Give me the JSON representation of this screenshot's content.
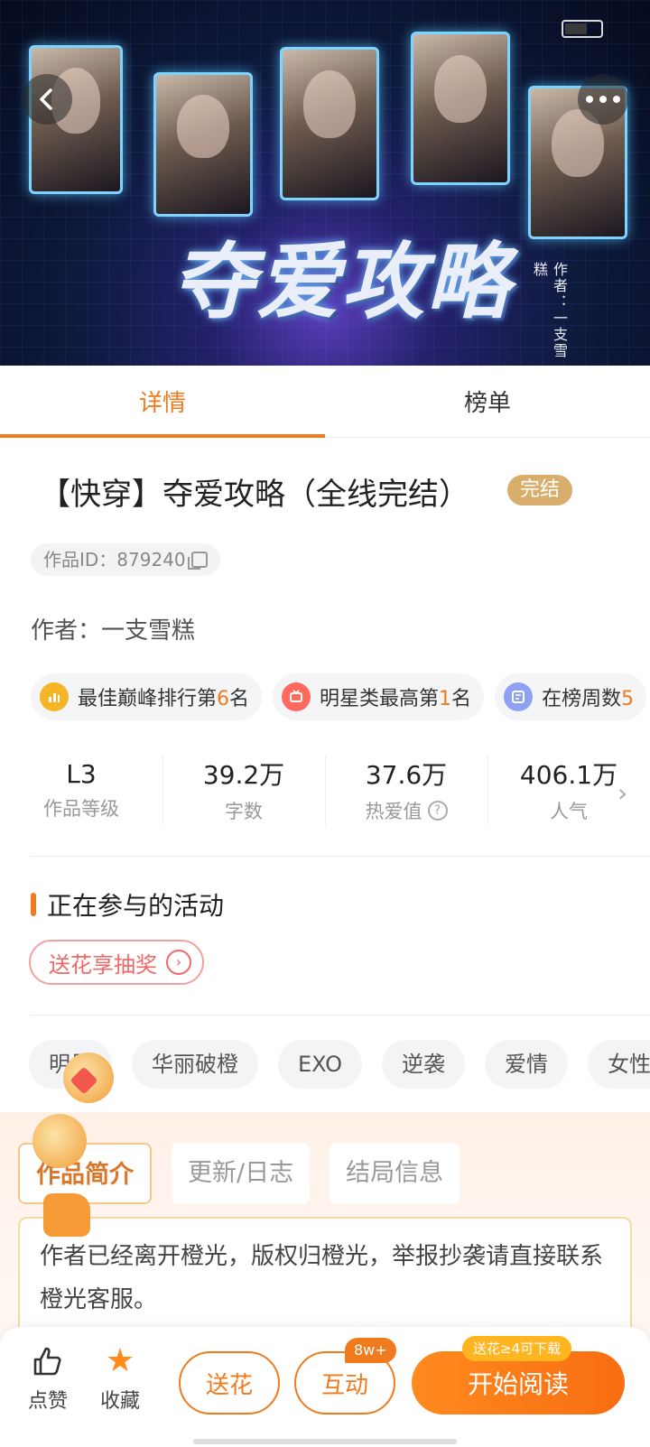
{
  "banner": {
    "title_art": "夺爱攻略",
    "author_art": "作者：一支雪糕",
    "back_glyph": "‹",
    "more_glyph": "•••"
  },
  "tabs": [
    {
      "label": "详情",
      "active": true
    },
    {
      "label": "榜单",
      "active": false
    }
  ],
  "book": {
    "title": "【快穿】夺爱攻略（全线完结）",
    "status_badge": "完结",
    "id_label": "作品ID：879240",
    "author_label": "作者：",
    "author_name": "一支雪糕"
  },
  "rank_chips": [
    {
      "prefix": "最佳巅峰排行第",
      "num": "6",
      "suffix": "名",
      "icon": "bar-chart-icon",
      "color": "#f5b526"
    },
    {
      "prefix": "明星类最高第",
      "num": "1",
      "suffix": "名",
      "icon": "tv-icon",
      "color": "#ff6a5e"
    },
    {
      "prefix": "在榜周数",
      "num": "5",
      "suffix": "",
      "icon": "list-icon",
      "color": "#8ea1f2"
    }
  ],
  "stats": [
    {
      "value": "L3",
      "label": "作品等级"
    },
    {
      "value": "39.2万",
      "label": "字数"
    },
    {
      "value": "37.6万",
      "label": "热爱值"
    },
    {
      "value": "406.1万",
      "label": "人气"
    }
  ],
  "activity": {
    "section_title": "正在参与的活动",
    "button_label": "送花享抽奖"
  },
  "tags": [
    "明星",
    "华丽破橙",
    "EXO",
    "逆袭",
    "爱情",
    "女性向"
  ],
  "intro": {
    "subtabs": [
      {
        "label": "作品简介",
        "active": true
      },
      {
        "label": "更新/日志",
        "active": false
      },
      {
        "label": "结局信息",
        "active": false
      }
    ],
    "text": "作者已经离开橙光，版权归橙光，举报抄袭请直接联系橙光客服。"
  },
  "bottom_bar": {
    "like_label": "点赞",
    "fav_label": "收藏",
    "flower_label": "送花",
    "interact_label": "互动",
    "interact_count": "8w+",
    "read_label": "开始阅读",
    "download_badge": "送花≥4可下载"
  },
  "colors": {
    "accent": "#f07a1e",
    "badge_gold": "#d9ae6c",
    "activity_red": "#f06868"
  }
}
